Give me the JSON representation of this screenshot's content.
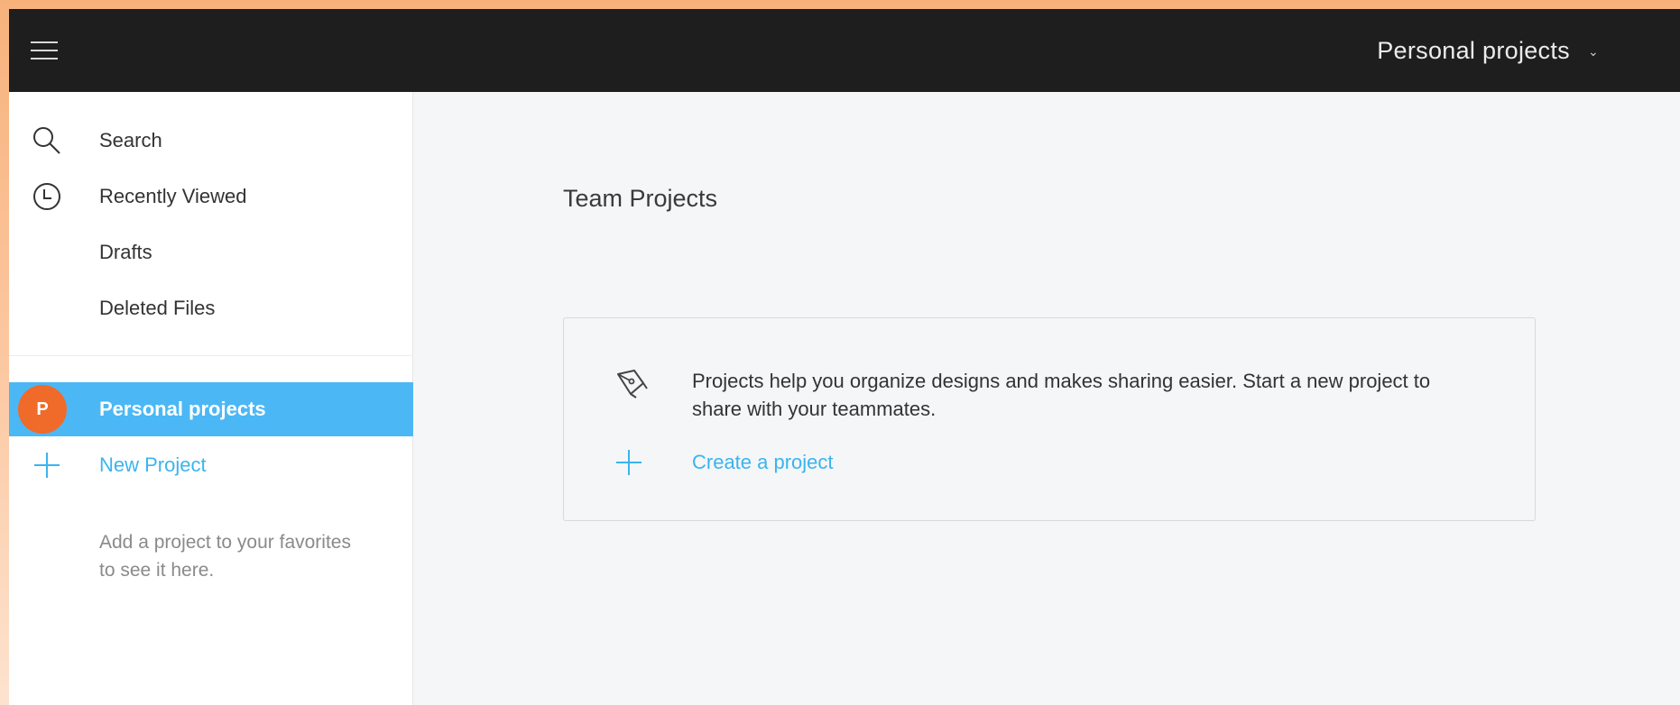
{
  "topbar": {
    "team_name": "Personal projects",
    "chevron": "chevron-down-icon"
  },
  "sidebar": {
    "items": [
      {
        "label": "Search",
        "icon": "search-icon"
      },
      {
        "label": "Recently Viewed",
        "icon": "clock-icon"
      },
      {
        "label": "Drafts"
      },
      {
        "label": "Deleted Files"
      }
    ],
    "projects": {
      "active": {
        "label": "Personal projects",
        "avatar_letter": "P",
        "avatar_color": "#f06a2a"
      },
      "new_project_label": "New Project"
    },
    "favorites_hint": "Add a project to your favorites to see it here."
  },
  "main": {
    "section_title": "Team Projects",
    "empty_card": {
      "message": "Projects help you organize designs and makes sharing easier. Start a new project to share with your teammates.",
      "create_label": "Create a project",
      "icon": "pen-tool-icon"
    }
  },
  "colors": {
    "accent": "#4bb8f5",
    "link": "#3ab4ef",
    "topbar": "#1e1e1e",
    "avatar": "#f06a2a"
  }
}
